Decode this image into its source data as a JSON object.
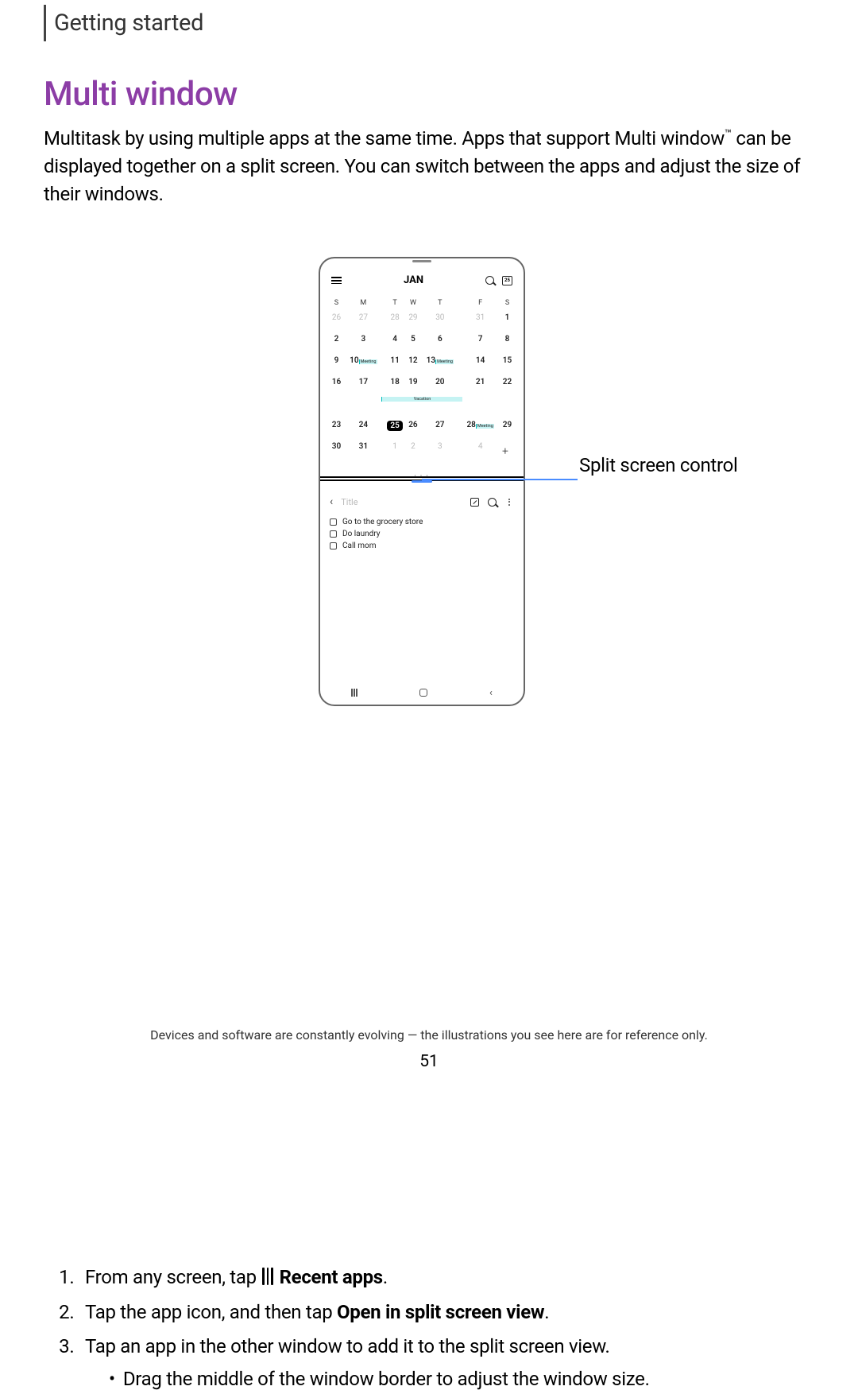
{
  "header": {
    "breadcrumb": "Getting started"
  },
  "title": "Multi window",
  "intro": {
    "p1a": "Multitask by using multiple apps at the same time. Apps that support Multi window",
    "tm": "™",
    "p1b": " can be displayed together on a split screen. You can switch between the apps and adjust the size of their windows."
  },
  "callout": {
    "split_screen_control": "Split screen control"
  },
  "calendar": {
    "month": "JAN",
    "today_badge": "25",
    "dow": [
      "S",
      "M",
      "T",
      "W",
      "T",
      "F",
      "S"
    ],
    "weeks": [
      [
        {
          "n": "26",
          "dim": true
        },
        {
          "n": "27",
          "dim": true
        },
        {
          "n": "28",
          "dim": true
        },
        {
          "n": "29",
          "dim": true
        },
        {
          "n": "30",
          "dim": true
        },
        {
          "n": "31",
          "dim": true
        },
        {
          "n": "1"
        }
      ],
      [
        {
          "n": "2"
        },
        {
          "n": "3"
        },
        {
          "n": "4"
        },
        {
          "n": "5"
        },
        {
          "n": "6"
        },
        {
          "n": "7"
        },
        {
          "n": "8"
        }
      ],
      [
        {
          "n": "9"
        },
        {
          "n": "10",
          "ev": "Meeting"
        },
        {
          "n": "11"
        },
        {
          "n": "12"
        },
        {
          "n": "13",
          "ev": "Meeting"
        },
        {
          "n": "14"
        },
        {
          "n": "15"
        }
      ],
      [
        {
          "n": "16"
        },
        {
          "n": "17"
        },
        {
          "n": "18"
        },
        {
          "n": "19"
        },
        {
          "n": "20"
        },
        {
          "n": "21"
        },
        {
          "n": "22"
        }
      ],
      [
        {
          "n": "23"
        },
        {
          "n": "24"
        },
        {
          "n": "25",
          "sel": true
        },
        {
          "n": "26"
        },
        {
          "n": "27"
        },
        {
          "n": "28",
          "ev": "Meeting"
        },
        {
          "n": "29"
        }
      ],
      [
        {
          "n": "30"
        },
        {
          "n": "31"
        },
        {
          "n": "1",
          "dim": true
        },
        {
          "n": "2",
          "dim": true
        },
        {
          "n": "3",
          "dim": true
        },
        {
          "n": "4",
          "dim": true
        },
        {
          "n": "+",
          "plus": true
        }
      ]
    ],
    "vacation_label": "Vacation"
  },
  "notes": {
    "title_placeholder": "Title",
    "items": [
      "Go to the grocery store",
      "Do laundry",
      "Call mom"
    ]
  },
  "steps": {
    "s1_a": "From any screen, tap",
    "s1_b": "Recent apps",
    "s1_c": ".",
    "s2_a": "Tap the app icon, and then tap ",
    "s2_b": "Open in split screen view",
    "s2_c": ".",
    "s3": "Tap an app in the other window to add it to the split screen view.",
    "s3_sub1": "Drag the middle of the window border to adjust the window size."
  },
  "footer": {
    "disclaimer": "Devices and software are constantly evolving — the illustrations you see here are for reference only.",
    "page": "51"
  }
}
